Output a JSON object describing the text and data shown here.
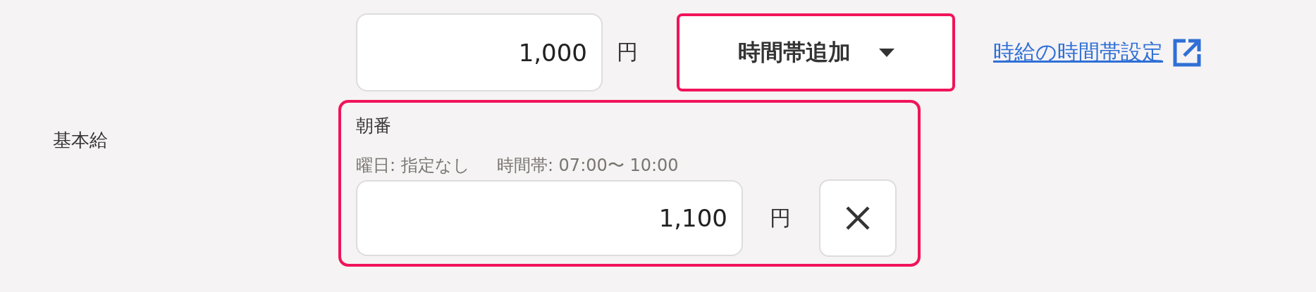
{
  "salary_row": {
    "label": "基本給",
    "base_rate": {
      "value": "1,000",
      "unit": "円"
    },
    "add_time_band_button": {
      "label": "時間帯追加",
      "highlighted": true
    },
    "settings_link": {
      "label": "時給の時間帯設定"
    },
    "time_bands": [
      {
        "name": "朝番",
        "weekday": "曜日: 指定なし",
        "hours": "時間帯: 07:00〜 10:00",
        "value": "1,100",
        "unit": "円",
        "highlighted": true
      }
    ]
  }
}
